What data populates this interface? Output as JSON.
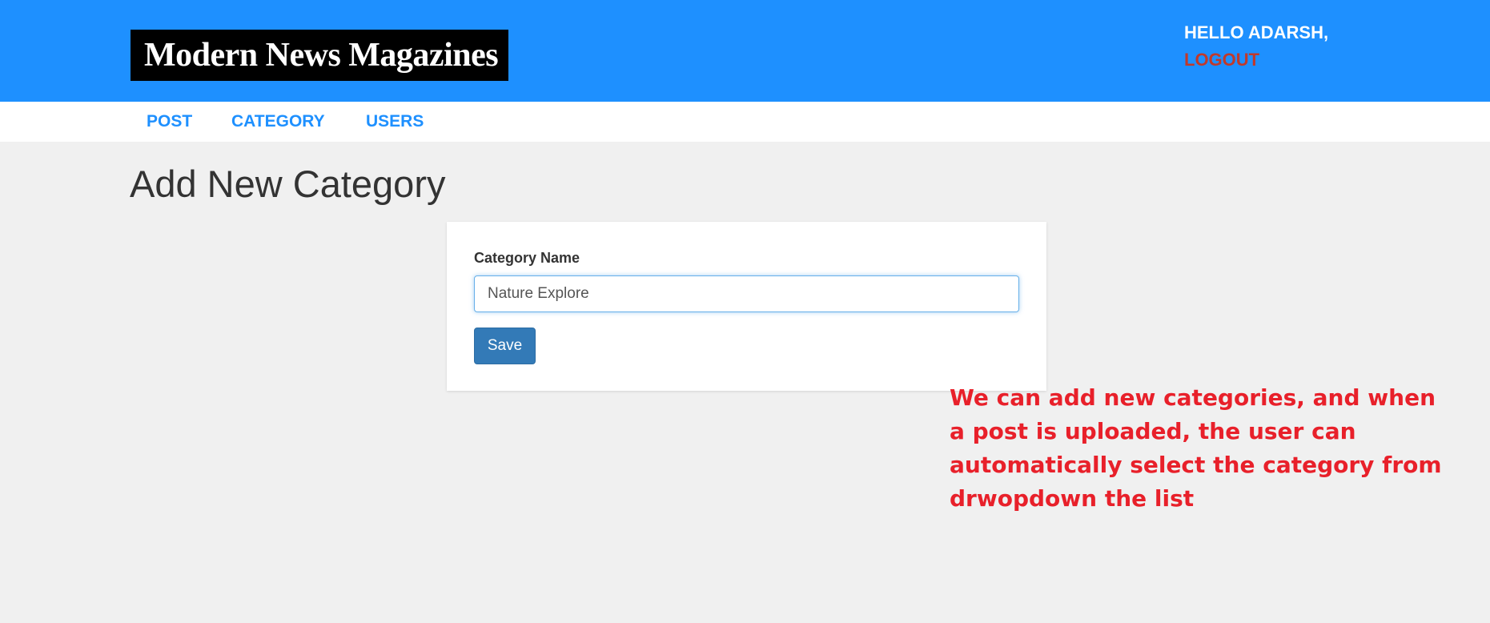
{
  "header": {
    "logo_text": "Modern News Magazines",
    "greeting": "HELLO ADARSH,",
    "logout_label": "LOGOUT"
  },
  "nav": {
    "items": [
      {
        "label": "POST"
      },
      {
        "label": "CATEGORY"
      },
      {
        "label": "USERS"
      }
    ]
  },
  "main": {
    "title": "Add New Category",
    "form": {
      "label": "Category Name",
      "input_value": "Nature Explore",
      "save_label": "Save"
    }
  },
  "annotation": {
    "text": "We can add new categories, and when a post is uploaded, the user can automatically select the category from drwopdown the list"
  },
  "colors": {
    "header_bg": "#1e90ff",
    "logout": "#c0392b",
    "nav_link": "#1e90ff",
    "button": "#337ab7",
    "annotation": "#e8202a"
  }
}
